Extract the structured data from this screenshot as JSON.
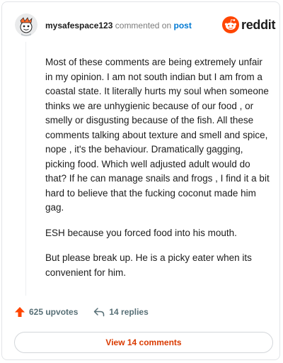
{
  "header": {
    "username": "mysafespace123",
    "action_text": "commented on",
    "post_link": "post",
    "brand": "reddit"
  },
  "comment": {
    "paragraphs": [
      "Most of these comments are being extremely unfair in my opinion. I am not south indian but I am from a coastal state. It literally hurts my soul when someone thinks we are unhygienic because of our food , or smelly or disgusting because of the fish. All these comments talking about texture and smell and spice, nope , it's the behaviour. Dramatically gagging, picking food. Which well adjusted adult would do that? If he can manage snails and frogs , I find it a bit hard to believe that the fucking coconut made him gag.",
      "ESH because you forced food into his mouth.",
      "But please break up. He is a picky eater when its convenient for him."
    ]
  },
  "actions": {
    "upvotes": "625 upvotes",
    "replies": "14 replies",
    "view_button": "View 14 comments"
  },
  "icons": {
    "avatar": "snoo-avatar-icon",
    "brand": "reddit-logo-icon",
    "upvote": "upvote-arrow-icon",
    "reply": "reply-arrow-icon"
  },
  "colors": {
    "brand_orange": "#ff4500",
    "link_blue": "#0079d3",
    "button_text": "#d93a00",
    "meta_gray": "#7c7c7c"
  }
}
